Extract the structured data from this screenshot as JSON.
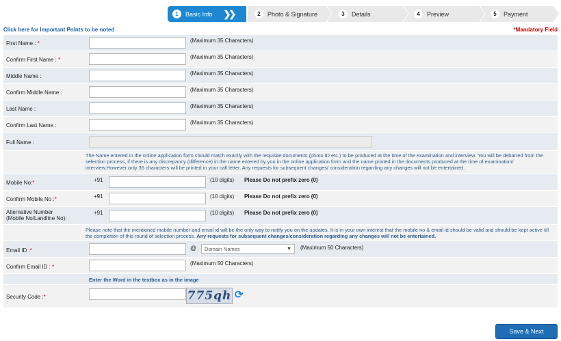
{
  "steps": [
    {
      "num": "1",
      "label": "Basic Info"
    },
    {
      "num": "2",
      "label": "Photo & Signature"
    },
    {
      "num": "3",
      "label": "Details"
    },
    {
      "num": "4",
      "label": "Preview"
    },
    {
      "num": "5",
      "label": "Payment"
    }
  ],
  "header": {
    "important_link": "Click here for Important Points to be noted",
    "mandatory": "*Mandatory Field"
  },
  "fields": {
    "first_name": {
      "label": "First Name :",
      "req": " *",
      "hint": "(Maximum 35 Characters)",
      "value": ""
    },
    "confirm_first_name": {
      "label": "Confirm First Name :",
      "req": " *",
      "hint": "(Maximum 35 Characters)",
      "value": ""
    },
    "middle_name": {
      "label": "Middle Name :",
      "hint": "(Maximum 35 Characters)",
      "value": ""
    },
    "confirm_middle_name": {
      "label": "Confirm Middle Name :",
      "hint": "(Maximum 35 Characters)",
      "value": ""
    },
    "last_name": {
      "label": "Last Name :",
      "hint": "(Maximum 35 Characters)",
      "value": ""
    },
    "confirm_last_name": {
      "label": "Confirm Last Name :",
      "hint": "(Maximum 35 Characters)",
      "value": ""
    },
    "full_name": {
      "label": "Full Name :",
      "value": ""
    },
    "name_note": "The Name entered in the online application form should match exactly with the requisite documents (photo ID etc.) to be produced at the time of the examination and interview. You will be debarred from the selection process, if there is any discrepancy (difference) in the name entered by you in the online application form and the name printed in the documents produced at the time of examination/ interview.However only 35 characters will be printed in your call letter. Any requests for subsequent changes/ consideration regarding any changes will not be entertained.",
    "mobile": {
      "label": "Mobile No:",
      "req": "*",
      "prefix": "+91",
      "hint": "(10 digits)",
      "warn": "Please Do not prefix zero (0)",
      "value": ""
    },
    "confirm_mobile": {
      "label": "Confirm Mobile No :",
      "req": "*",
      "prefix": "+91",
      "hint": "(10 digits)",
      "warn": "Please Do not prefix zero (0)",
      "value": ""
    },
    "alt_number": {
      "label1": "Alternative Number",
      "label2": "(Mobile No/Landline No):",
      "prefix": "+91",
      "hint": "(10 digits)",
      "warn": "Please Do not prefix zero (0)",
      "value": ""
    },
    "contact_note": "Please note that the mentioned mobile number and email id will be the only way to notify you on the updates. It is in your own interest that the mobile no & email id should be valid and should be kept active till the completion of this round of selection process. ",
    "contact_note_bold": "Any requests for subsequent changes/consideration regarding any changes will not be entertained.",
    "email": {
      "label": "Email ID :",
      "req": "*",
      "at": "@",
      "domain": "Domain Names",
      "hint": "(Maximum 50 Characters)",
      "value": ""
    },
    "confirm_email": {
      "label": "Confirm Email ID :",
      "req": " *",
      "hint": "(Maximum 50 Characters)",
      "value": ""
    },
    "captcha_instr": "Enter the Word in the textbox as in the image",
    "security": {
      "label": "Security Code :",
      "req": "*",
      "captcha_text": "775qh",
      "value": ""
    }
  },
  "footer": {
    "save_next": "Save & Next"
  },
  "colors": {
    "accent": "#1e87d2",
    "row_a": "#f2f2f2",
    "row_b": "#e5ebf1",
    "required": "#cc0000"
  },
  "icons": {
    "refresh": "refresh-icon",
    "chevrons": "double-chevron-icon"
  }
}
